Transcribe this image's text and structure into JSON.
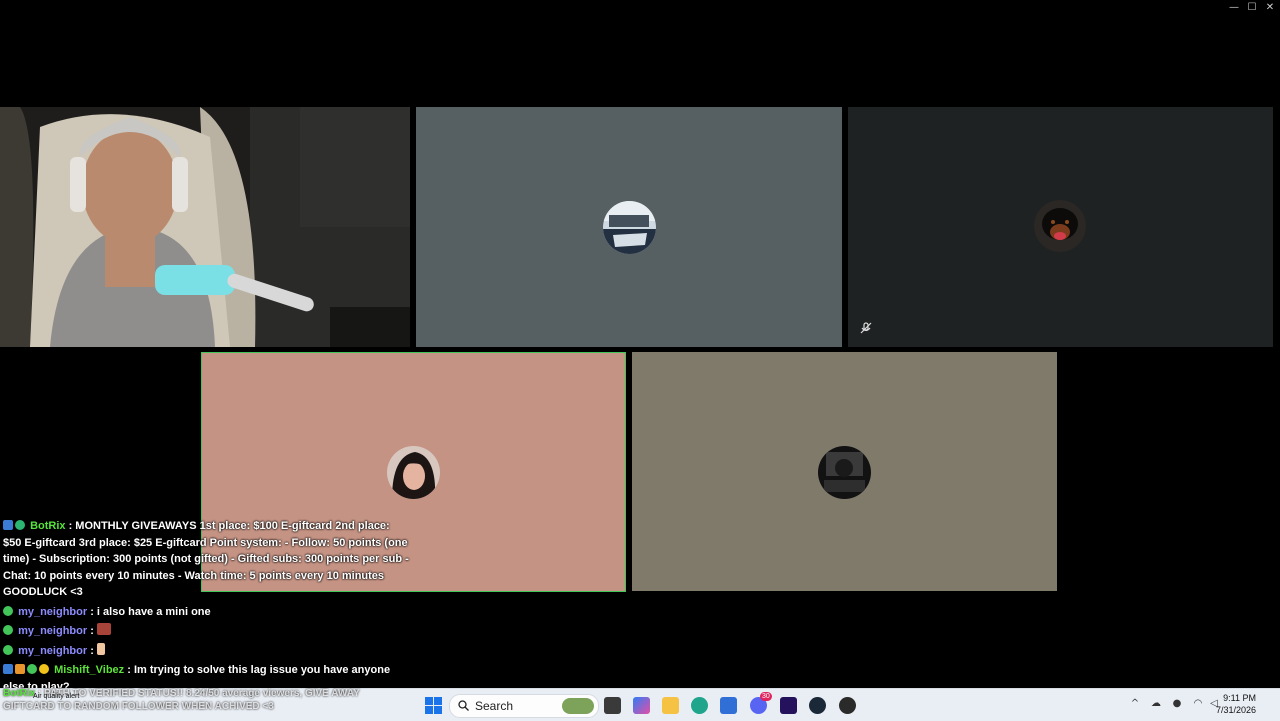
{
  "window": {
    "controls": {
      "minimize": "—",
      "maximize": "☐",
      "close": "✕"
    }
  },
  "tiles": {
    "webcam": {
      "label": "streamer-camera"
    },
    "tile2": {
      "bg": "#566063"
    },
    "tile3": {
      "bg": "#1f2223"
    },
    "tile4": {
      "bg": "#c49384",
      "border": "#43c55a"
    },
    "tile5": {
      "bg": "#807a6b"
    }
  },
  "chat": {
    "messages": [
      {
        "user": "BotRix",
        "user_color": "#57e43b",
        "text": ": MONTHLY GIVEAWAYS 1st place: $100 E-giftcard 2nd place: $50 E-giftcard 3rd place: $25 E-giftcard Point system: - Follow: 50 points (one time) - Subscription: 300 points (not gifted) - Gifted subs: 300 points per sub - Chat: 10 points every 10 minutes - Watch time: 5 points every 10 minutes GOODLUCK <3"
      },
      {
        "user": "my_neighbor",
        "user_color": "#8c8cff",
        "text": ": i also have a mini one"
      },
      {
        "user": "my_neighbor",
        "user_color": "#8c8cff",
        "text": ":"
      },
      {
        "user": "my_neighbor",
        "user_color": "#8c8cff",
        "text": ":"
      },
      {
        "user": "Mishift_Vibez",
        "user_color": "#5de33b",
        "text": ": Im trying to solve this lag issue you have anyone else to play?"
      }
    ],
    "ticker": {
      "user": "BotRix",
      "text": ": PATH TO VERIFIED STATUS!! 8.24/50 average viewers, GIVE AWAY GIFTCARD TO RANDOM FOLLOWER WHEN ACHIVED <3",
      "overlay": "Air quality alert"
    }
  },
  "taskbar": {
    "search_placeholder": "Search",
    "time": "9:11 PM",
    "date": "7/31/2026",
    "apps": [
      "windows-start",
      "search",
      "task-view",
      "copilot",
      "file-explorer",
      "edge",
      "microsoft-store",
      "discord",
      "amazon-music",
      "steam",
      "obs"
    ],
    "badges": {
      "discord": "30"
    }
  }
}
